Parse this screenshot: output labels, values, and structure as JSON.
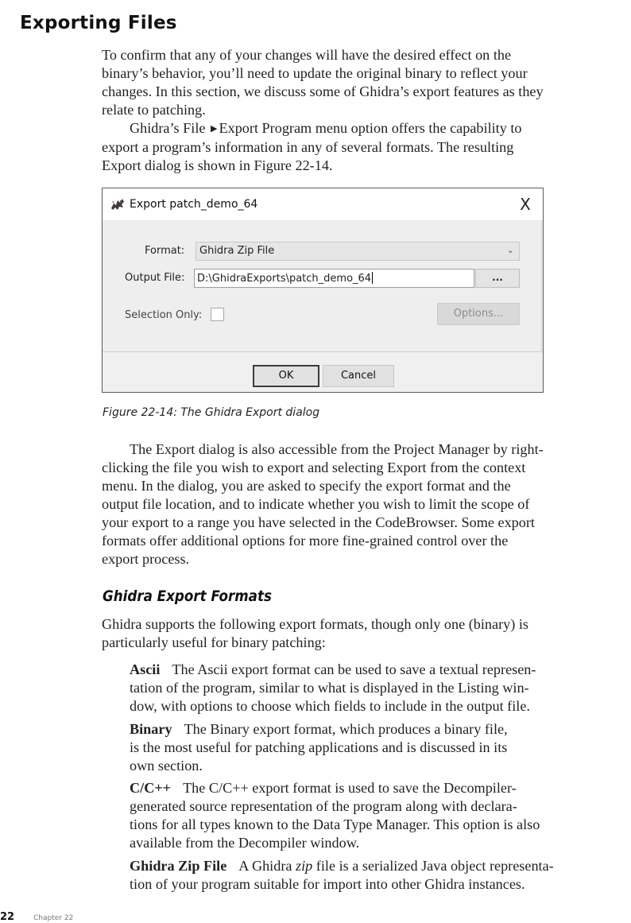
{
  "heading": "Exporting Files",
  "intro_lines": [
    "To confirm that any of your changes will have the desired effect on the",
    "binary’s behavior, you’ll need to update the original binary to reflect your",
    "changes. In this section, we discuss some of Ghidra’s export features as they",
    "relate to patching."
  ],
  "menu_para": {
    "line1_before": "Ghidra’s File",
    "arrow": "▶",
    "line1_after": "Export Program menu option offers the capability to",
    "line2": "export a program’s information in any of several formats. The resulting",
    "line3": "Export dialog is shown in Figure 22-14."
  },
  "dialog": {
    "title": "Export patch_demo_64",
    "close": "X",
    "format_label": "Format:",
    "format_value": "Ghidra Zip File",
    "format_arrow": "⌄",
    "output_label": "Output File:",
    "output_value": "D:\\GhidraExports\\patch_demo_64",
    "browse_label": "...",
    "selection_label": "Selection Only:",
    "selection_checked": false,
    "options_label": "Options...",
    "ok_label": "OK",
    "cancel_label": "Cancel"
  },
  "caption": "Figure 22-14: The Ghidra Export dialog",
  "body_lines": [
    "The Export dialog is also accessible from the Project Manager by right-",
    "clicking the file you wish to export and selecting Export from the context",
    "menu. In the dialog, you are asked to specify the export format and the",
    "output file location, and to indicate whether you wish to limit the scope of",
    "your export to a range you have selected in the CodeBrowser. Some export",
    "formats offer additional options for more fine-grained control over the",
    "export process."
  ],
  "subheading": "Ghidra Export Formats",
  "formats_intro_lines": [
    "Ghidra supports the following export formats, though only one (binary) is",
    "particularly useful for binary patching:"
  ],
  "formats": {
    "ascii": {
      "term": "Ascii",
      "first": "The Ascii export format can be used to save a textual represen-",
      "rest": [
        "tation of the program, similar to what is displayed in the Listing win-",
        "dow, with options to choose which fields to include in the output file."
      ]
    },
    "binary": {
      "term": "Binary",
      "first": "The Binary export format, which produces a binary file,",
      "rest": [
        "is the most useful for patching applications and is discussed in its",
        "own section."
      ]
    },
    "cpp": {
      "term": "C/C++",
      "first": "The C/C++ export format is used to save the Decompiler-",
      "rest": [
        "generated source representation of the program along with declara-",
        "tions for all types known to the Data Type Manager. This option is also",
        "available from the Decompiler window."
      ]
    },
    "zip": {
      "term": "Ghidra Zip File",
      "first_before": "A Ghidra",
      "first_em": "zip",
      "first_after": "file is a serialized Java object representa-",
      "rest": [
        "tion of your program suitable for import into other Ghidra instances."
      ]
    }
  },
  "footer": {
    "page_number": "22",
    "chapter": "Chapter 22"
  }
}
